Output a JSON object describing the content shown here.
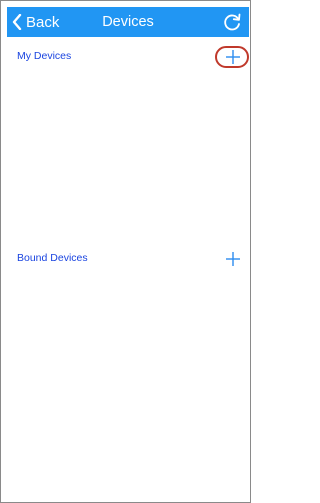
{
  "navbar": {
    "back_label": "Back",
    "title": "Devices",
    "back_icon": "chevron-left-icon",
    "refresh_icon": "refresh-icon",
    "background": "#2196f3"
  },
  "sections": {
    "my_devices": {
      "title": "My Devices",
      "add_icon": "plus-icon"
    },
    "bound_devices": {
      "title": "Bound Devices",
      "add_icon": "plus-icon"
    }
  },
  "colors": {
    "accent": "#1a44e0",
    "plus": "#2b8cf0",
    "highlight": "#c0392b"
  }
}
